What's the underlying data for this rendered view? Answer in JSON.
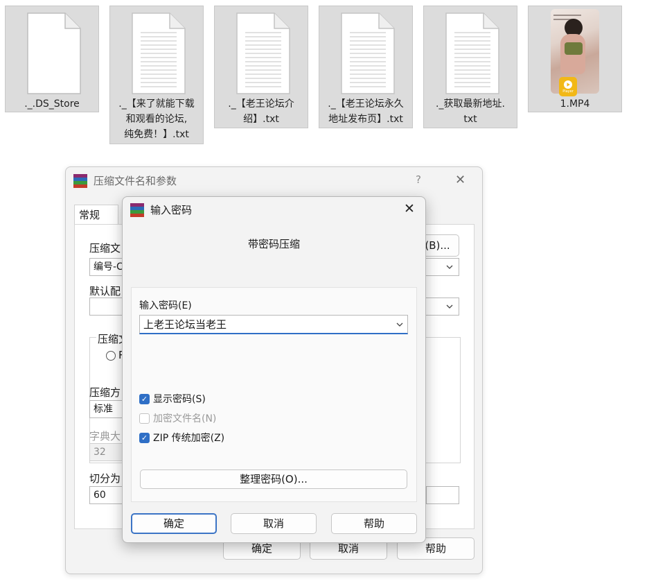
{
  "files": [
    {
      "name": "._.DS_Store",
      "type": "file"
    },
    {
      "name": "._【来了就能下载\n和观看的论坛,\n纯免费！】.txt",
      "type": "text"
    },
    {
      "name": "._【老王论坛介\n绍】.txt",
      "type": "text"
    },
    {
      "name": "._【老王论坛永久\n地址发布页】.txt",
      "type": "text"
    },
    {
      "name": "._获取最新地址.\ntxt",
      "type": "text"
    },
    {
      "name": "1.MP4",
      "type": "video",
      "badge": "Player"
    }
  ],
  "back_dialog": {
    "title": "压缩文件名和参数",
    "help_glyph": "?",
    "close_glyph": "✕",
    "tab_general": "常规",
    "archive_name_label": "压缩文",
    "archive_name_value": "编号-C",
    "browse_button": "(B)...",
    "default_profile_label": "默认配",
    "format_group_label": "压缩文",
    "format_radio": "R",
    "method_label": "压缩方",
    "method_value": "标准",
    "dict_label": "字典大",
    "dict_value": "32",
    "split_label": "切分为",
    "split_value": "60",
    "ok": "确定",
    "cancel": "取消",
    "help": "帮助"
  },
  "front_dialog": {
    "title": "输入密码",
    "close_glyph": "✕",
    "subtitle": "带密码压缩",
    "password_label": "输入密码(E)",
    "password_value": "上老王论坛当老王",
    "show_password": {
      "label": "显示密码(S)",
      "checked": true
    },
    "encrypt_names": {
      "label": "加密文件名(N)",
      "checked": false,
      "disabled": true
    },
    "zip_legacy": {
      "label": "ZIP 传统加密(Z)",
      "checked": true
    },
    "organize_button": "整理密码(O)...",
    "ok": "确定",
    "cancel": "取消",
    "help": "帮助"
  },
  "colors": {
    "accent": "#2f6fc6",
    "player_badge": "#f2b817"
  },
  "icons": {
    "app": "winrar-books-icon",
    "check": "checkmark-icon",
    "dropdown": "chevron-down-icon"
  }
}
